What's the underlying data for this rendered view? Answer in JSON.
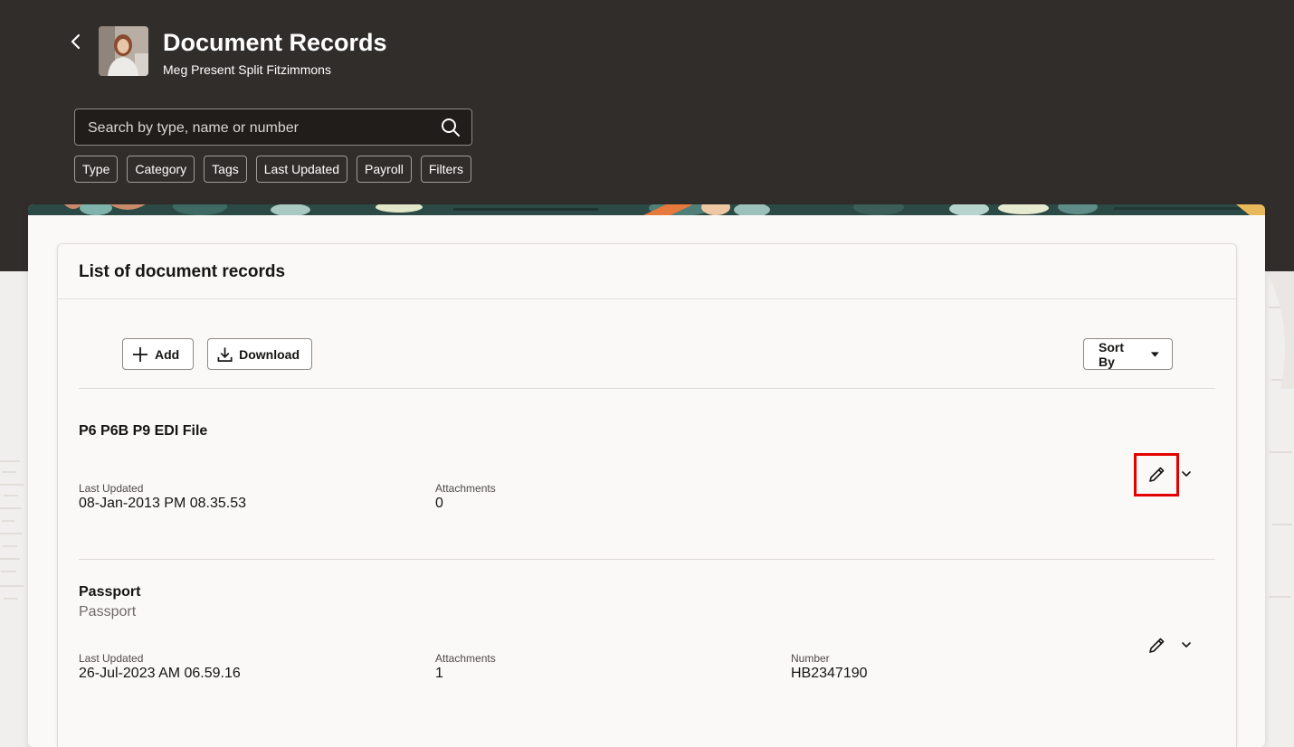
{
  "header": {
    "title": "Document Records",
    "subtitle": "Meg Present Split Fitzimmons"
  },
  "search": {
    "placeholder": "Search by type, name or number",
    "value": ""
  },
  "filters": [
    "Type",
    "Category",
    "Tags",
    "Last Updated",
    "Payroll",
    "Filters"
  ],
  "list": {
    "title": "List of document records",
    "add_label": "Add",
    "download_label": "Download",
    "sort_label": "Sort By",
    "records": [
      {
        "name": "P6 P6B P9 EDI File",
        "subtitle": "",
        "last_updated_label": "Last Updated",
        "last_updated": "08-Jan-2013 PM 08.35.53",
        "attachments_label": "Attachments",
        "attachments": "0"
      },
      {
        "name": "Passport",
        "subtitle": "Passport",
        "last_updated_label": "Last Updated",
        "last_updated": "26-Jul-2023 AM 06.59.16",
        "attachments_label": "Attachments",
        "attachments": "1",
        "number_label": "Number",
        "number": "HB2347190"
      }
    ]
  },
  "icons": {
    "back": "chevron-left-icon",
    "search": "search-icon",
    "add": "plus-icon",
    "download": "download-icon",
    "sort": "caret-down-icon",
    "edit": "pencil-icon",
    "expand": "chevron-down-icon"
  },
  "colors": {
    "header_bg": "#312d2a",
    "highlight": "#e30000",
    "card_bg": "#faf9f8"
  }
}
